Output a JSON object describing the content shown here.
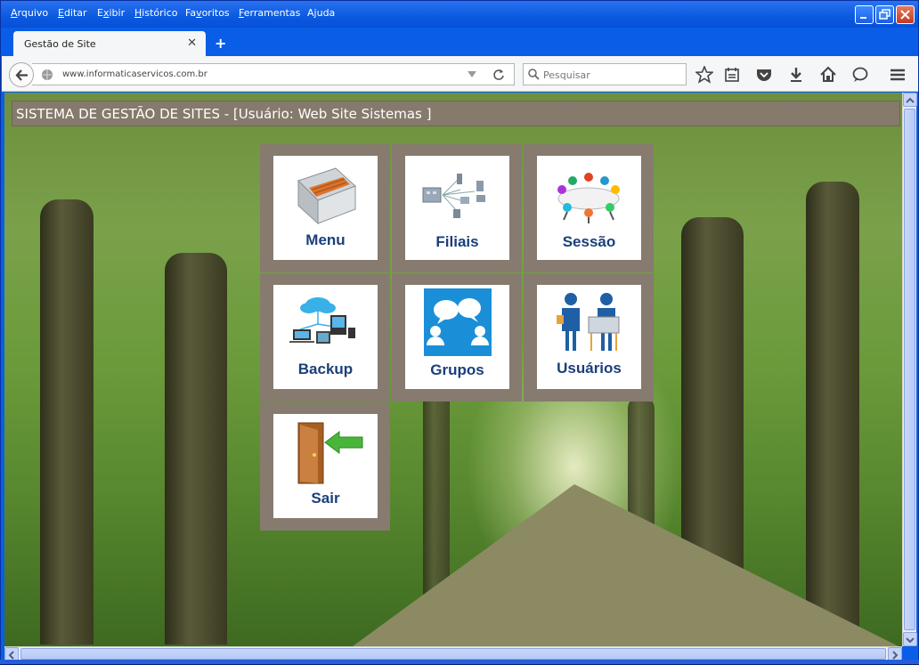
{
  "menu": {
    "items": [
      "Arquivo",
      "Editar",
      "Exibir",
      "Histórico",
      "Favoritos",
      "Ferramentas",
      "Ajuda"
    ],
    "underline": [
      "A",
      "E",
      "x",
      "H",
      "v",
      "F",
      "j"
    ]
  },
  "tab": {
    "title": "Gestão de Site",
    "close": "✕",
    "new": "+"
  },
  "navbar": {
    "url": "www.informaticaservicos.com.br",
    "search_placeholder": "Pesquisar"
  },
  "page": {
    "header": "SISTEMA DE GESTÃO DE SITES -  [Usuário:  Web Site Sistemas ]",
    "tiles": [
      {
        "label": "Menu",
        "icon": "card-file-icon"
      },
      {
        "label": "Filiais",
        "icon": "network-icon"
      },
      {
        "label": "Sessão",
        "icon": "meeting-icon"
      },
      {
        "label": "Backup",
        "icon": "cloud-backup-icon"
      },
      {
        "label": "Grupos",
        "icon": "chat-bubbles-icon"
      },
      {
        "label": "Usuários",
        "icon": "users-icon"
      },
      {
        "label": "Sair",
        "icon": "exit-door-icon"
      }
    ]
  },
  "colors": {
    "titlebar": "#0a5de6",
    "tile_frame": "#867b6e",
    "tile_label": "#1a3f7a",
    "header_bar": "#857a6c"
  }
}
